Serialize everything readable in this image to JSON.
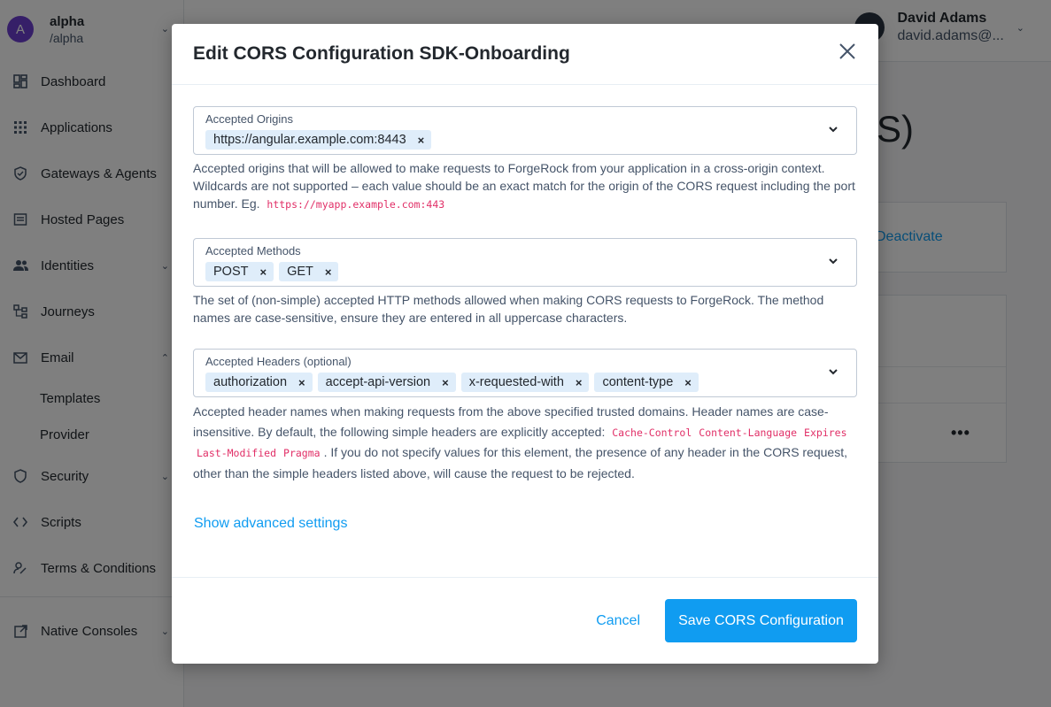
{
  "realm": {
    "avatar_letter": "A",
    "name": "alpha",
    "path": "/alpha"
  },
  "sidebar": {
    "items": [
      {
        "label": "Dashboard",
        "icon": "dashboard-icon"
      },
      {
        "label": "Applications",
        "icon": "apps-grid-icon"
      },
      {
        "label": "Gateways & Agents",
        "icon": "shield-check-icon"
      },
      {
        "label": "Hosted Pages",
        "icon": "web-page-icon"
      },
      {
        "label": "Identities",
        "icon": "people-icon"
      },
      {
        "label": "Journeys",
        "icon": "journey-tree-icon"
      },
      {
        "label": "Email",
        "icon": "mail-icon"
      },
      {
        "label": "Security",
        "icon": "shield-icon"
      },
      {
        "label": "Scripts",
        "icon": "code-icon"
      },
      {
        "label": "Terms & Conditions",
        "icon": "signature-icon"
      },
      {
        "label": "Native Consoles",
        "icon": "external-link-icon"
      }
    ],
    "email_sub": [
      "Templates",
      "Provider"
    ]
  },
  "user": {
    "name": "David Adams",
    "email": "david.adams@..."
  },
  "background": {
    "title_fragment": "S)",
    "deactivate_label": "Deactivate"
  },
  "modal": {
    "title": "Edit CORS Configuration SDK-Onboarding",
    "origins": {
      "label": "Accepted Origins",
      "tags": [
        "https://angular.example.com:8443"
      ],
      "help_1": "Accepted origins that will be allowed to make requests to ForgeRock from your application in a cross-origin context. Wildcards are not supported – each value should be an exact match for the origin of the CORS request including the port number. Eg.",
      "help_code": "https://myapp.example.com:443"
    },
    "methods": {
      "label": "Accepted Methods",
      "tags": [
        "POST",
        "GET"
      ],
      "help": "The set of (non-simple) accepted HTTP methods allowed when making CORS requests to ForgeRock. The method names are case-sensitive, ensure they are entered in all uppercase characters."
    },
    "headers": {
      "label": "Accepted Headers (optional)",
      "tags": [
        "authorization",
        "accept-api-version",
        "x-requested-with",
        "content-type"
      ],
      "help_1": "Accepted header names when making requests from the above specified trusted domains. Header names are case-insensitive. By default, the following simple headers are explicitly accepted:",
      "help_codes": [
        "Cache-Control",
        "Content-Language",
        "Expires",
        "Last-Modified",
        "Pragma"
      ],
      "help_2": ". If you do not specify values for this element, the presence of any header in the CORS request, other than the simple headers listed above, will cause the request to be rejected."
    },
    "advanced_link": "Show advanced settings",
    "cancel_label": "Cancel",
    "save_label": "Save CORS Configuration"
  },
  "colors": {
    "accent": "#109cf1",
    "tag_bg": "#dfedfa",
    "code": "#e12f67",
    "avatar": "#6d3fd0"
  }
}
